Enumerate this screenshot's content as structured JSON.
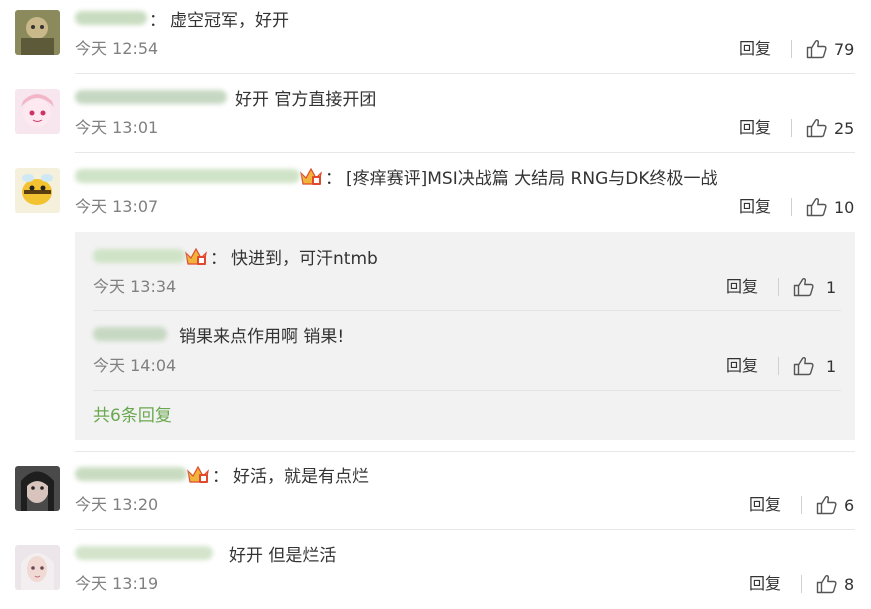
{
  "comments": [
    {
      "text": "虚空冠军，好开",
      "time": "今天 12:54",
      "reply": "回复",
      "likes": "79",
      "name_color": "#c8dcc0"
    },
    {
      "text": "好开 官方直接开团",
      "time": "今天 13:01",
      "reply": "回复",
      "likes": "25",
      "name_color": "#c6d8c2"
    },
    {
      "text": "[疼痒赛评]MSI决战篇 大结局 RNG与DK终极一战",
      "time": "今天 13:07",
      "reply": "回复",
      "likes": "10",
      "name_color": "#cfe3c6"
    },
    {
      "text": "好活，就是有点烂",
      "time": "今天 13:20",
      "reply": "回复",
      "likes": "6",
      "name_color": "#c9dcc1"
    },
    {
      "text": "好开 但是烂活",
      "time": "今天 13:19",
      "reply": "回复",
      "likes": "8",
      "name_color": "#d3e4cb"
    }
  ],
  "sub_replies": [
    {
      "text": "快进到，可汗ntmb",
      "time": "今天 13:34",
      "reply": "回复",
      "likes": "1"
    },
    {
      "text": "销果来点作用啊 销果!",
      "time": "今天 14:04",
      "reply": "回复",
      "likes": "1"
    }
  ],
  "more_replies": "共6条回复",
  "colon": "：",
  "icons": {
    "like": "thumbs-up-icon",
    "badge": "crown-badge-icon"
  },
  "colors": {
    "accent_green": "#6aa84f",
    "time_gray": "#808080",
    "text": "#333333",
    "sub_bg": "#f2f2f2"
  }
}
